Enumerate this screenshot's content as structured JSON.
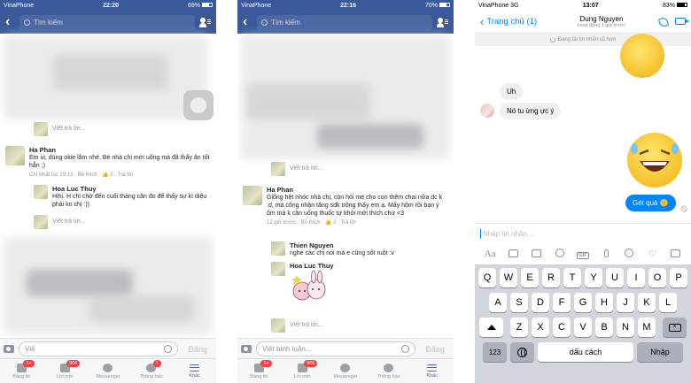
{
  "panel1": {
    "status": {
      "carrier": "VinaPhone",
      "time": "22:20",
      "battery": "69%",
      "battery_level": 0.69
    },
    "search_placeholder": "Tìm kiếm",
    "reply_label": "Viết trả lời...",
    "comment1": {
      "name": "Ha Phan",
      "text": "Em ui, dùng okie lắm nhé. Bé nhà chị mới uống mà đã thấy ăn tốt hẳn ;)",
      "meta": "Chỉ Nhật lúc 19:13 · Bé thích ·",
      "likes": "2",
      "reply_link": "Trả lời"
    },
    "reply1": {
      "name": "Hoa Luc Thuy",
      "text": "Hihi. H chỉ chờ đến cuối tháng cân đo để thấy sự kì diệu phải ko chị :))"
    },
    "composer_placeholder": "Viế",
    "post_label": "Đăng",
    "tabs": [
      {
        "label": "Bảng tin",
        "badge": "1+"
      },
      {
        "label": "Lời mời",
        "badge": "906"
      },
      {
        "label": "Messenger",
        "badge": ""
      },
      {
        "label": "Thông báo",
        "badge": "1"
      },
      {
        "label": "Khác",
        "badge": ""
      }
    ]
  },
  "panel2": {
    "status": {
      "carrier": "VinaPhone",
      "time": "22:16",
      "battery": "70%",
      "battery_level": 0.7
    },
    "search_placeholder": "Tìm kiếm",
    "reply_label": "Viết trả lời...",
    "comment1": {
      "name": "Ha Phan",
      "text": "Giống hệt nhóc nhà chị, còn hỏi mẹ cho con thêm chai nữa dc k :d, mà công nhận tăng sdk trông thấy em ạ. Mấy hôm rồi bạn ý ốm mà k cần uống thuốc tự khỏi mới thích chứ <3",
      "meta": "12 giờ trước · Bỏ thích ·",
      "likes": "2",
      "reply_link": "Trả lời"
    },
    "reply1": {
      "name": "Thien Nguyen",
      "text": "nghe các chị nói mà e cũng sốt ruột :v"
    },
    "reply2": {
      "name": "Hoa Luc Thuy"
    },
    "composer_placeholder": "Viết bình luận...",
    "post_label": "Đăng",
    "tabs": [
      {
        "label": "Bảng tin",
        "badge": "1+"
      },
      {
        "label": "Lời mời",
        "badge": "906"
      },
      {
        "label": "Messenger",
        "badge": ""
      },
      {
        "label": "Thông báo",
        "badge": ""
      },
      {
        "label": "Khác",
        "badge": ""
      }
    ]
  },
  "panel3": {
    "status": {
      "carrier": "VinaPhone",
      "network": "3G",
      "time": "13:07",
      "battery": "83%",
      "battery_level": 0.83
    },
    "back_label": "Trang chủ (1)",
    "contact_name": "Dung Nguyen",
    "contact_status": "Hoạt động 1 giờ trước",
    "loading_text": "Đang tải tin nhắn cũ hơn",
    "messages": [
      {
        "dir": "in",
        "text": "Uh"
      },
      {
        "dir": "in",
        "text": "Nó tu ừng ực ý"
      },
      {
        "dir": "out",
        "text": "Gét quá"
      }
    ],
    "input_placeholder": "Nhập tin nhắn...",
    "tool_aa": "Aa",
    "keyboard": {
      "row1": [
        "Q",
        "W",
        "E",
        "R",
        "T",
        "Y",
        "U",
        "I",
        "O",
        "P"
      ],
      "row2": [
        "A",
        "S",
        "D",
        "F",
        "G",
        "H",
        "J",
        "K",
        "L"
      ],
      "row3": [
        "Z",
        "X",
        "C",
        "V",
        "B",
        "N",
        "M"
      ],
      "num_key": "123",
      "space_key": "dấu cách",
      "return_key": "Nhập"
    }
  },
  "colors": {
    "fb_blue": "#3b5998",
    "messenger_blue": "#0084ff",
    "badge_red": "#fa3e3e"
  }
}
